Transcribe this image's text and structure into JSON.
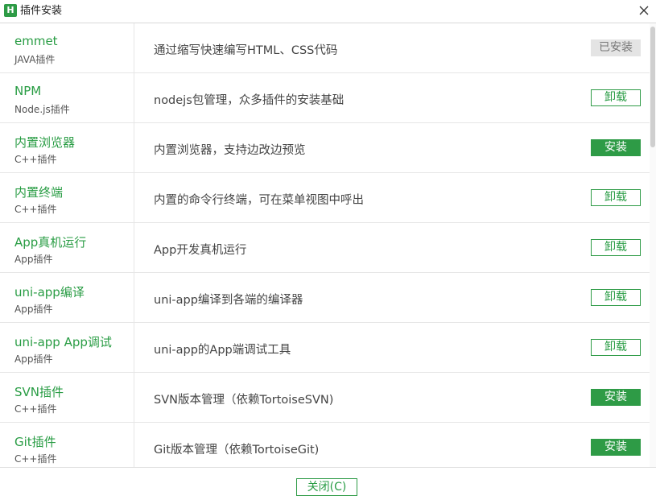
{
  "window": {
    "icon_letter": "H",
    "title": "插件安装"
  },
  "plugins": [
    {
      "name": "emmet",
      "type": "JAVA插件",
      "desc": "通过缩写快速编写HTML、CSS代码",
      "action": "已安装",
      "state": "installed"
    },
    {
      "name": "NPM",
      "type": "Node.js插件",
      "desc": "nodejs包管理，众多插件的安装基础",
      "action": "卸载",
      "state": "uninstall"
    },
    {
      "name": "内置浏览器",
      "type": "C++插件",
      "desc": "内置浏览器，支持边改边预览",
      "action": "安装",
      "state": "install"
    },
    {
      "name": "内置终端",
      "type": "C++插件",
      "desc": "内置的命令行终端，可在菜单视图中呼出",
      "action": "卸载",
      "state": "uninstall"
    },
    {
      "name": "App真机运行",
      "type": "App插件",
      "desc": "App开发真机运行",
      "action": "卸载",
      "state": "uninstall"
    },
    {
      "name": "uni-app编译",
      "type": "App插件",
      "desc": "uni-app编译到各端的编译器",
      "action": "卸载",
      "state": "uninstall"
    },
    {
      "name": "uni-app App调试",
      "type": "App插件",
      "desc": "uni-app的App端调试工具",
      "action": "卸载",
      "state": "uninstall"
    },
    {
      "name": "SVN插件",
      "type": "C++插件",
      "desc": "SVN版本管理（依赖TortoiseSVN)",
      "action": "安装",
      "state": "install"
    },
    {
      "name": "Git插件",
      "type": "C++插件",
      "desc": "Git版本管理（依赖TortoiseGit)",
      "action": "安装",
      "state": "install"
    }
  ],
  "footer": {
    "close_label": "关闭(C)"
  },
  "colors": {
    "accent": "#2e9b46",
    "installed_bg": "#e4e4e4"
  }
}
